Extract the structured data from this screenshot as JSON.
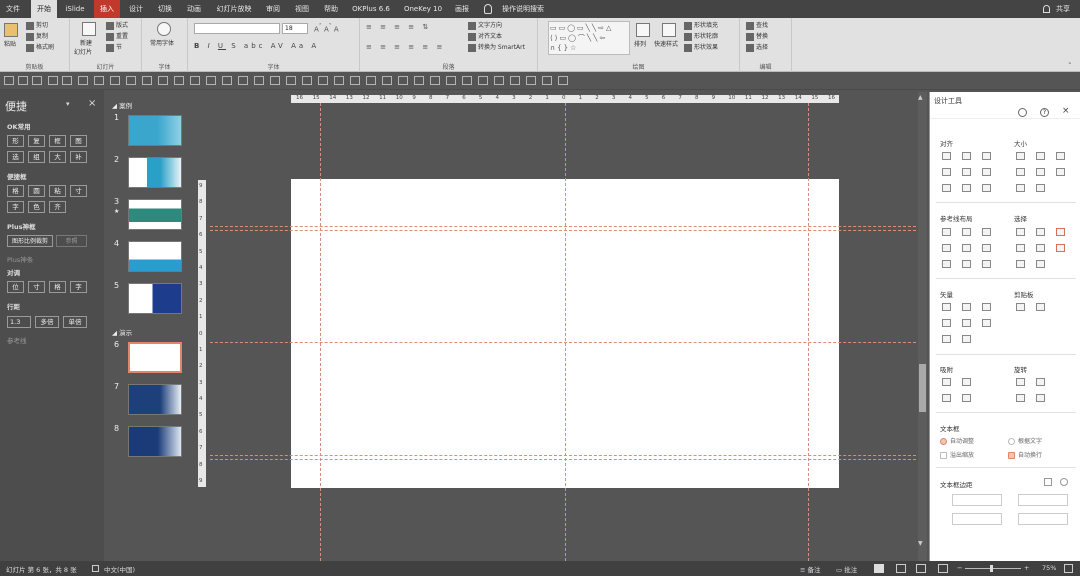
{
  "menu": {
    "tabs": [
      "文件",
      "开始",
      "iSlide",
      "插入",
      "设计",
      "切换",
      "动画",
      "幻灯片放映",
      "审阅",
      "视图",
      "帮助",
      "OKPlus 6.6",
      "OneKey 10",
      "画报"
    ],
    "active_tab": "开始",
    "highlight_tab": "插入",
    "tell_me": "操作说明搜索",
    "share": "共享"
  },
  "ribbon": {
    "clipboard": {
      "paste": "粘贴",
      "cut": "剪切",
      "copy": "复制",
      "format_painter": "格式刷",
      "label": "剪贴板"
    },
    "slides": {
      "new_slide": "新建",
      "new_slide2": "幻灯片",
      "layout": "版式",
      "reset": "重置",
      "section": "节",
      "label": "幻灯片"
    },
    "font_group": {
      "font_sub": "常用字体",
      "label": "字体",
      "size": "18"
    },
    "font": {
      "label": "字体"
    },
    "paragraph": {
      "text_direction": "文字方向",
      "align_text": "对齐文本",
      "smartart": "转换为 SmartArt",
      "label": "段落"
    },
    "drawing": {
      "arrange": "排列",
      "quick_styles": "快速样式",
      "fill": "形状填充",
      "outline": "形状轮廓",
      "effects": "形状效果",
      "label": "绘图"
    },
    "editing": {
      "find": "查找",
      "replace": "替换",
      "select": "选择",
      "label": "编辑"
    }
  },
  "left_panel": {
    "title": "便捷",
    "sections": {
      "ok_common": "OK常用",
      "convenient": "便捷框",
      "plus_shape": "Plus神框",
      "plus_dim": "Plus神条",
      "align": "对调",
      "line_spacing": "行距",
      "guides": "参考线"
    },
    "ok_buttons": [
      "形",
      "复",
      "框",
      "图",
      "选",
      "组",
      "大",
      "补"
    ],
    "conv_buttons": [
      "格",
      "圆",
      "粘",
      "寸",
      "字",
      "色",
      "齐"
    ],
    "plus_btn": "图形比例裁剪",
    "plus_btn2": "参照",
    "align_buttons": [
      "位",
      "寸",
      "格",
      "字"
    ],
    "spacing_value": "1.3",
    "spacing_btn1": "多倍",
    "spacing_btn2": "单倍"
  },
  "thumbs": {
    "section1": "案例",
    "section2": "演示",
    "numbers": [
      "1",
      "2",
      "3",
      "4",
      "5",
      "6",
      "7",
      "8"
    ],
    "star": "★"
  },
  "ruler": {
    "h": [
      "16",
      "15",
      "14",
      "13",
      "12",
      "11",
      "10",
      "9",
      "8",
      "7",
      "6",
      "5",
      "4",
      "3",
      "2",
      "1",
      "0",
      "1",
      "2",
      "3",
      "4",
      "5",
      "6",
      "7",
      "8",
      "9",
      "10",
      "11",
      "12",
      "13",
      "14",
      "15",
      "16"
    ],
    "v": [
      "9",
      "8",
      "7",
      "6",
      "5",
      "4",
      "3",
      "2",
      "1",
      "0",
      "1",
      "2",
      "3",
      "4",
      "5",
      "6",
      "7",
      "8",
      "9"
    ]
  },
  "right_panel": {
    "title": "设计工具",
    "align": "对齐",
    "size": "大小",
    "guide_layout": "参考线布局",
    "select": "选择",
    "vector": "矢量",
    "clipboard": "剪贴板",
    "snap": "吸附",
    "rotate": "旋转",
    "textbox": "文本框",
    "auto_fit": "自动调整",
    "wrap_text": "溢出缩放",
    "shrink": "根据文字",
    "auto_wrap": "自动换行",
    "textbox_margin": "文本框边距"
  },
  "status": {
    "slide_info": "幻灯片 第 6 张，共 8 张",
    "language": "中文(中国)",
    "notes": "备注",
    "comments": "批注",
    "zoom": "75%"
  },
  "colors": {
    "accent": "#e0866a",
    "highlight_tab": "#c0392b",
    "menubar": "#444444",
    "workspace": "#555555"
  }
}
